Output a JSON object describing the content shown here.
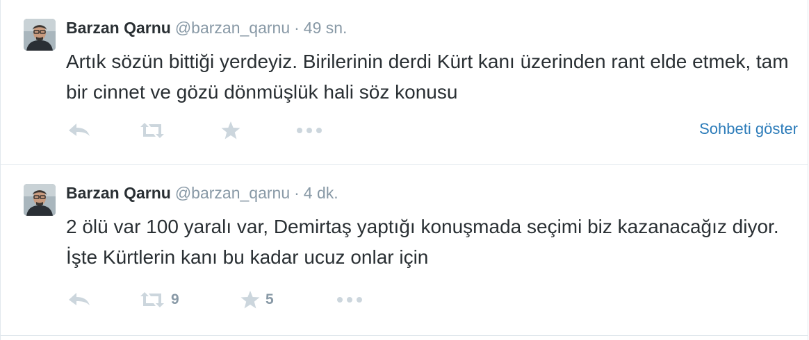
{
  "tweets": [
    {
      "fullname": "Barzan Qarnu",
      "username": "@barzan_qarnu",
      "separator": "·",
      "time": "49 sn.",
      "text": "Artık sözün bittiği yerdeyiz. Birilerinin derdi Kürt kanı üzerinden rant elde etmek, tam bir cinnet ve gözü dönmüşlük hali söz konusu",
      "retweet_count": "",
      "favorite_count": "",
      "conversation_link": "Sohbeti göster",
      "icons": [
        "reply-icon",
        "retweet-icon",
        "favorite-star-icon",
        "more-dots-icon"
      ]
    },
    {
      "fullname": "Barzan Qarnu",
      "username": "@barzan_qarnu",
      "separator": "·",
      "time": "4 dk.",
      "text": "2 ölü var 100 yaralı var, Demirtaş yaptığı konuşmada seçimi biz kazanacağız diyor. İşte Kürtlerin kanı bu kadar ucuz onlar için",
      "retweet_count": "9",
      "favorite_count": "5",
      "conversation_link": "",
      "icons": [
        "reply-icon",
        "retweet-icon",
        "favorite-star-icon",
        "more-dots-icon"
      ]
    }
  ],
  "colors": {
    "link": "#2b7bb9",
    "text": "#292f33",
    "muted": "#8899a6",
    "icon": "#ccd6dd",
    "border": "#e1e8ed"
  }
}
